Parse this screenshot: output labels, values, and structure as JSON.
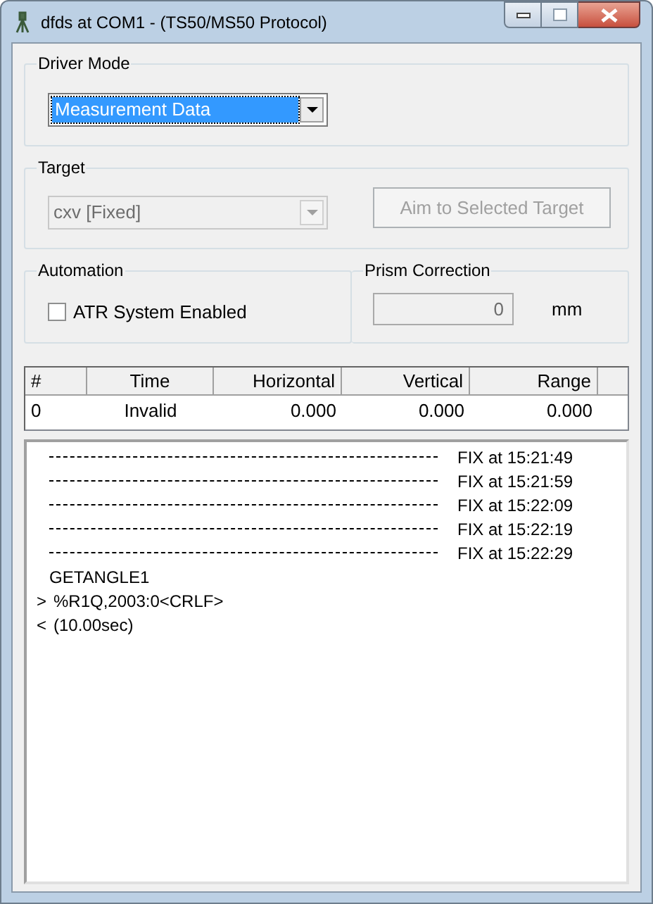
{
  "window": {
    "title": "dfds at COM1  -  (TS50/MS50 Protocol)"
  },
  "driver_mode": {
    "label": "Driver Mode",
    "value": "Measurement Data",
    "focused": true
  },
  "target": {
    "label": "Target",
    "value": "cxv [Fixed]",
    "disabled": true,
    "button": {
      "label": "Aim to Selected Target",
      "disabled": true
    }
  },
  "automation": {
    "label": "Automation",
    "checkbox": {
      "label": "ATR System Enabled",
      "checked": false
    }
  },
  "prism_correction": {
    "label": "Prism Correction",
    "value": "0",
    "unit": "mm",
    "disabled": true
  },
  "table": {
    "columns": [
      {
        "label": "#"
      },
      {
        "label": "Time"
      },
      {
        "label": "Horizontal"
      },
      {
        "label": "Vertical"
      },
      {
        "label": "Range"
      }
    ],
    "rows": [
      [
        "0",
        "Invalid",
        "0.000",
        "0.000",
        "0.000"
      ]
    ]
  },
  "log": [
    {
      "kind": "fix",
      "text": "FIX at 15:21:49"
    },
    {
      "kind": "fix",
      "text": "FIX at 15:21:59"
    },
    {
      "kind": "fix",
      "text": "FIX at 15:22:09"
    },
    {
      "kind": "fix",
      "text": "FIX at 15:22:19"
    },
    {
      "kind": "fix",
      "text": "FIX at 15:22:29"
    },
    {
      "kind": "plain",
      "text": "GETANGLE1"
    },
    {
      "kind": "io",
      "prefix": ">",
      "text": "%R1Q,2003:0<CRLF>"
    },
    {
      "kind": "io",
      "prefix": "<",
      "text": "(10.00sec)"
    }
  ]
}
